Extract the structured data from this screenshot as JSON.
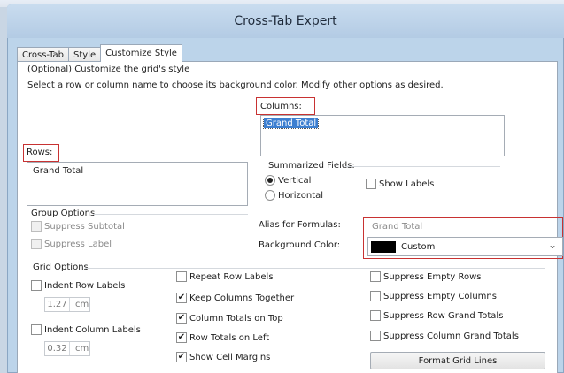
{
  "window": {
    "title": "Cross-Tab Expert"
  },
  "tabs": [
    {
      "label": "Cross-Tab"
    },
    {
      "label": "Style"
    },
    {
      "label": "Customize Style"
    }
  ],
  "intro": {
    "line1": "(Optional) Customize the grid's style",
    "line2": "Select a row or column name to choose its background color.  Modify other options as desired."
  },
  "columns": {
    "label": "Columns:",
    "items": [
      "Grand Total"
    ]
  },
  "rows": {
    "label": "Rows:",
    "items": [
      "Grand Total"
    ]
  },
  "summarized": {
    "label": "Summarized Fields:",
    "vertical": "Vertical",
    "horizontal": "Horizontal",
    "selected": "Vertical",
    "show_labels": "Show Labels"
  },
  "group_options": {
    "label": "Group Options",
    "suppress_subtotal": "Suppress Subtotal",
    "suppress_label": "Suppress Label"
  },
  "alias": {
    "label": "Alias for Formulas:",
    "value": "Grand Total"
  },
  "background": {
    "label": "Background Color:",
    "value": "Custom",
    "color": "#000000"
  },
  "grid_options": {
    "label": "Grid  Options",
    "indent_row_labels": "Indent Row Labels",
    "indent_row_value": "1.27",
    "indent_column_labels": "Indent Column Labels",
    "indent_column_value": "0.32",
    "unit": "cm",
    "repeat_row_labels": "Repeat Row Labels",
    "keep_columns_together": "Keep Columns Together",
    "column_totals_on_top": "Column Totals on Top",
    "row_totals_on_left": "Row Totals on Left",
    "show_cell_margins": "Show Cell Margins",
    "suppress_empty_rows": "Suppress Empty Rows",
    "suppress_empty_columns": "Suppress Empty Columns",
    "suppress_row_grand_totals": "Suppress Row Grand Totals",
    "suppress_column_grand_totals": "Suppress Column Grand Totals",
    "format_grid_lines": "Format Grid Lines"
  },
  "check_glyph": "✔",
  "dropdown_glyph": "⌄"
}
